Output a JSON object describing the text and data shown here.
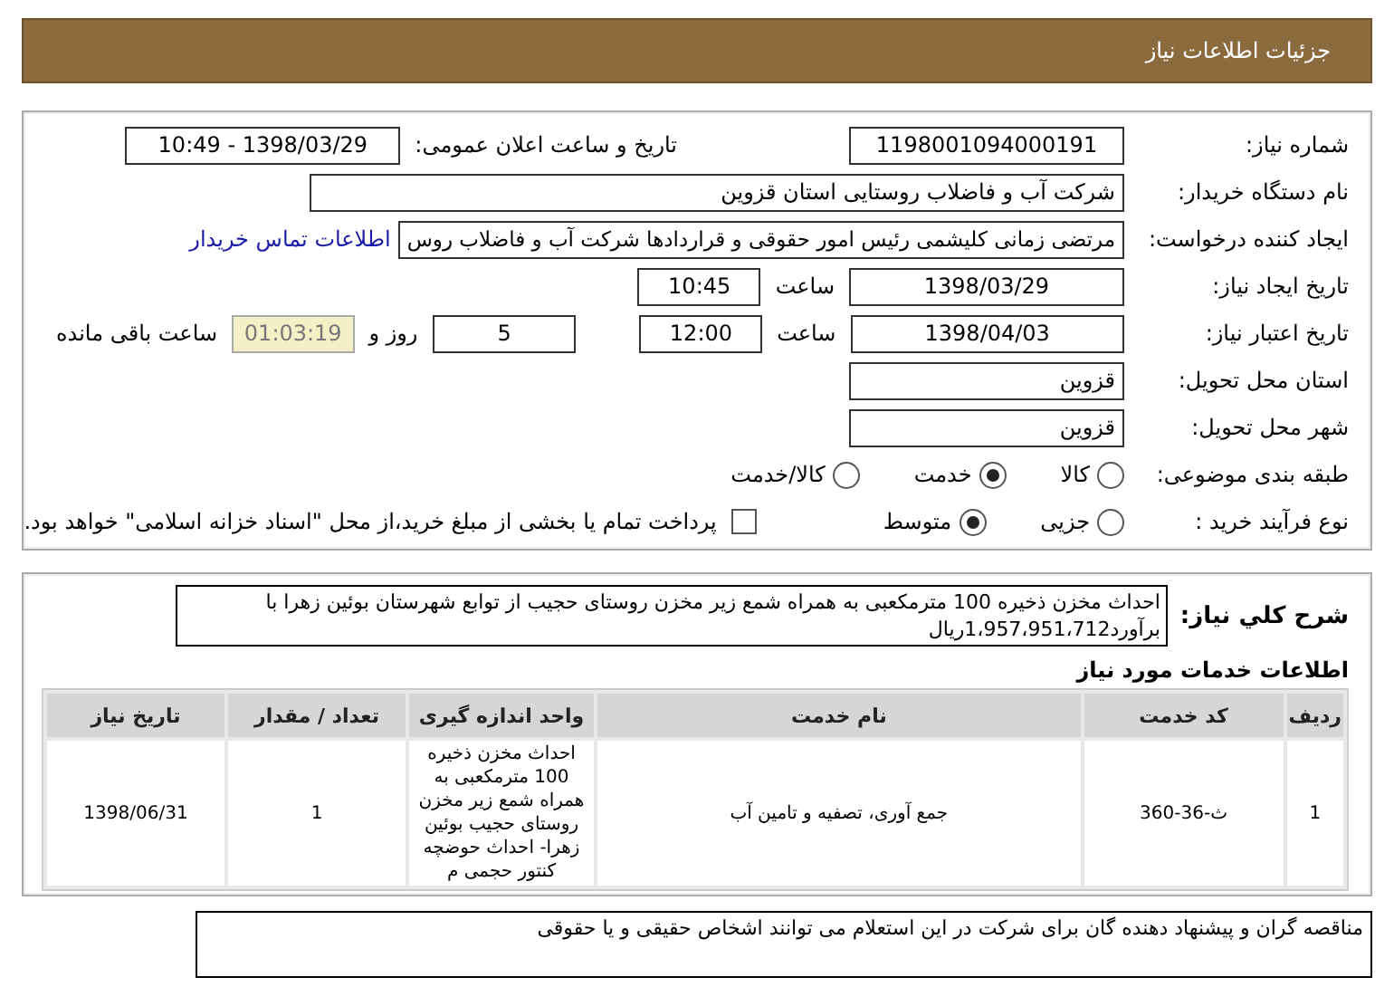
{
  "header": {
    "title": "جزئیات اطلاعات نیاز"
  },
  "need_number": {
    "label": "شماره نیاز:",
    "value": "1198001094000191"
  },
  "announce": {
    "label": "تاریخ و ساعت اعلان عمومی:",
    "value": "1398/03/29 - 10:49"
  },
  "buyer": {
    "label": "نام دستگاه خریدار:",
    "value": "شرکت آب و فاضلاب روستایی استان قزوین"
  },
  "requester": {
    "label": "ایجاد کننده درخواست:",
    "value": "مرتضی زمانی کلیشمی رئیس امور حقوقی و قراردادها شرکت آب و فاضلاب روس",
    "link": "اطلاعات تماس خریدار"
  },
  "created": {
    "label": "تاریخ ایجاد نیاز:",
    "date": "1398/03/29",
    "time_label": "ساعت",
    "time": "10:45"
  },
  "validity": {
    "label": "تاریخ اعتبار نیاز:",
    "date": "1398/04/03",
    "time_label": "ساعت",
    "time": "12:00",
    "days": "5",
    "days_label": "روز و",
    "remaining": "01:03:19",
    "remaining_label": "ساعت باقی مانده"
  },
  "province": {
    "label": "استان محل تحویل:",
    "value": "قزوین"
  },
  "city": {
    "label": "شهر محل تحویل:",
    "value": "قزوین"
  },
  "category": {
    "label": "طبقه بندی موضوعی:",
    "options": [
      {
        "label": "کالا",
        "selected": false
      },
      {
        "label": "خدمت",
        "selected": true
      },
      {
        "label": "کالا/خدمت",
        "selected": false
      }
    ]
  },
  "process": {
    "label": "نوع فرآیند خرید :",
    "options": [
      {
        "label": "جزیی",
        "selected": false
      },
      {
        "label": "متوسط",
        "selected": true
      }
    ],
    "payment": {
      "label": "پرداخت تمام یا بخشی از مبلغ خرید،از محل \"اسناد خزانه اسلامی\" خواهد بود.",
      "checked": false
    }
  },
  "description": {
    "label": "شرح کلي نياز:",
    "value": "احداث مخزن ذخیره 100 مترمکعبی به همراه شمع زیر مخزن روستای حجیب  از توابع شهرستان بوئین زهرا با برآورد1،957،951،712ریال"
  },
  "services": {
    "title": "اطلاعات خدمات مورد نیاز",
    "table": {
      "columns": [
        "ردیف",
        "کد خدمت",
        "نام خدمت",
        "واحد اندازه گیری",
        "تعداد / مقدار",
        "تاریخ نیاز"
      ],
      "rows": [
        [
          "1",
          "ث-36-360",
          "جمع آوری، تصفیه و تامین آب",
          "احداث مخزن ذخیره 100 مترمکعبی به همراه شمع زیر مخزن روستای حجیب بوئین زهرا- احداث حوضچه کنتور حجمی م",
          "1",
          "1398/06/31"
        ]
      ]
    }
  },
  "note": "مناقصه گران و پیشنهاد دهنده گان  برای شرکت در این استعلام  می توانند اشخاص حقیقی و یا حقوقی"
}
